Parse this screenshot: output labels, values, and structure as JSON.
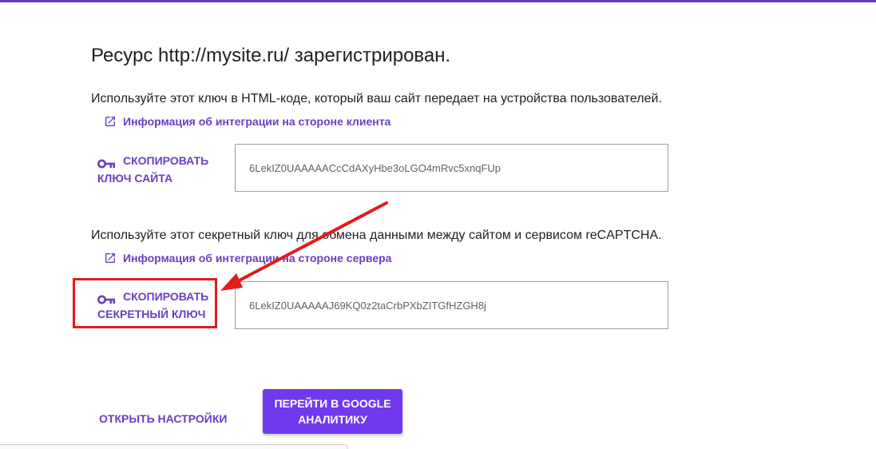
{
  "header": {
    "title": "Ресурс http://mysite.ru/ зарегистрирован."
  },
  "client_section": {
    "description": "Используйте этот ключ в HTML-коде, который ваш сайт передает на устройства пользователей.",
    "info_link": "Информация об интеграции на стороне клиента",
    "copy_button_line1": "Скопировать",
    "copy_button_line2": "ключ сайта",
    "key_value": "6LekIZ0UAAAAACcCdAXyHbe3oLGO4mRvc5xnqFUp"
  },
  "server_section": {
    "description": "Используйте этот секретный ключ для обмена данными между сайтом и сервисом reCAPTCHA.",
    "info_link": "Информация об интеграции на стороне сервера",
    "copy_button_line1": "Скопировать",
    "copy_button_line2": "секретный ключ",
    "key_value": "6LekIZ0UAAAAAJ69KQ0z2taCrbPXbZITGfHZGH8j"
  },
  "footer": {
    "settings_button": "Открыть настройки",
    "analytics_button": "Перейти в Google Аналитику"
  },
  "colors": {
    "accent": "#6a3dc4",
    "primary_button": "#7139ee",
    "annotation_red": "#e51a1a",
    "top_bar": "#673ab7"
  },
  "icons": {
    "link_icon": "open-in-new-icon",
    "copy_icon": "key-icon"
  }
}
